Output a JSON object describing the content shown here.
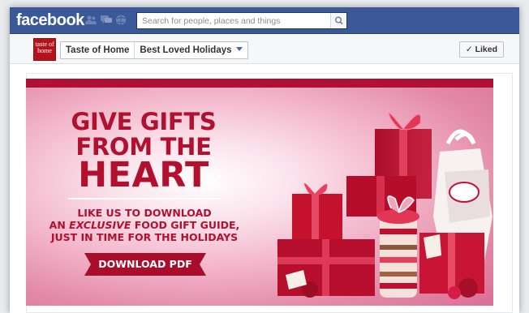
{
  "topbar": {
    "logo": "facebook",
    "search": {
      "placeholder": "Search for people, places and things",
      "value": ""
    },
    "icons": [
      "friend-requests-icon",
      "messages-icon",
      "notifications-icon",
      "search-icon"
    ]
  },
  "pagebar": {
    "thumb_text": "taste of home",
    "crumbs": [
      "Taste of Home",
      "Best Loved Holidays"
    ],
    "liked_label": "✓ Liked"
  },
  "banner": {
    "headline": [
      "GIVE GIFTS",
      "FROM THE",
      "HEART"
    ],
    "sub_line1": "LIKE US TO DOWNLOAD",
    "sub_line2_pre": "AN ",
    "sub_line2_em": "EXCLUSIVE",
    "sub_line2_post": " FOOD GIFT GUIDE,",
    "sub_line3": "JUST IN TIME FOR THE HOLIDAYS",
    "cta": "DOWNLOAD PDF"
  },
  "colors": {
    "fb_blue": "#3b5998",
    "brand_red": "#b2102f",
    "banner_pink": "#f3b7cb"
  }
}
